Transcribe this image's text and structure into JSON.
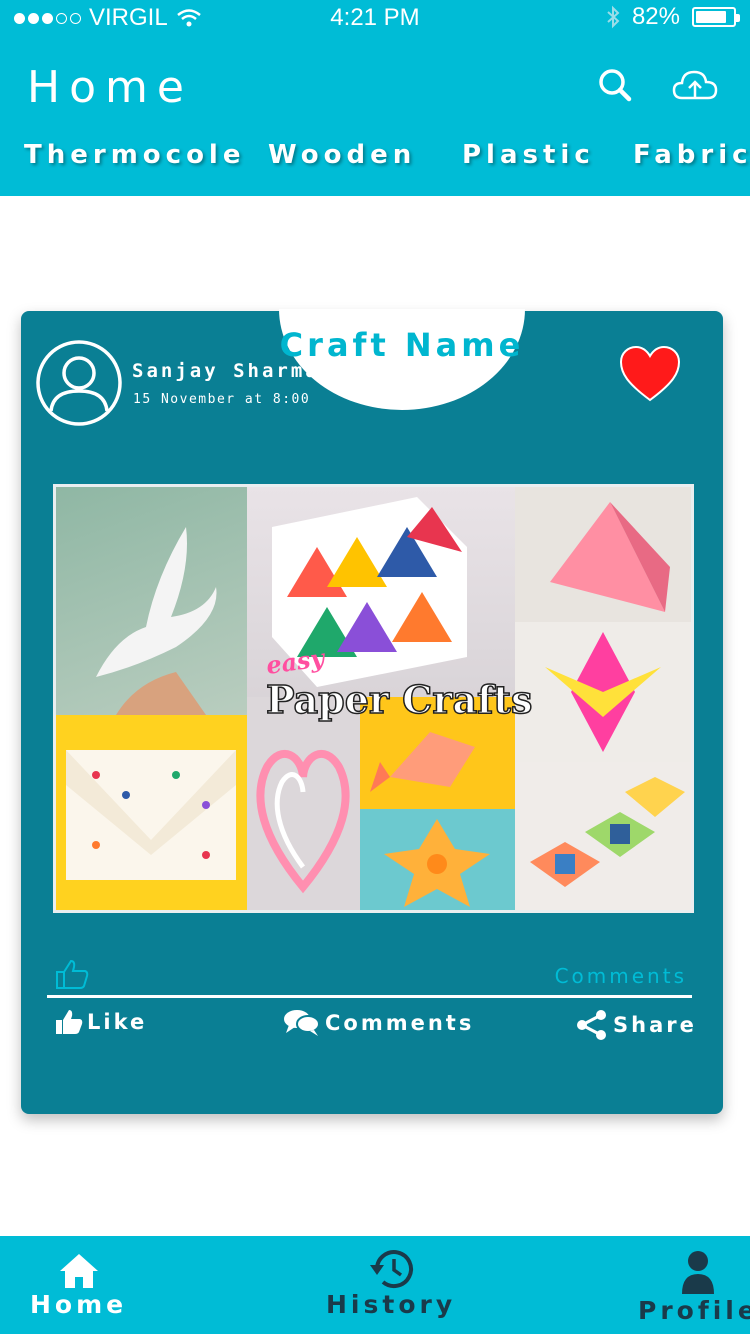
{
  "status_bar": {
    "carrier": "VIRGIL",
    "time": "4:21 PM",
    "battery": "82%",
    "battery_level": 0.82
  },
  "header": {
    "title": "Home",
    "search_icon": "search-icon",
    "upload_icon": "cloud-upload-icon"
  },
  "categories": [
    "Thermocole",
    "Wooden",
    "Plastic",
    "Fabric"
  ],
  "post": {
    "craft_name": "Craft Name",
    "author": "Sanjay Sharma",
    "date": "15 November at 8:00",
    "favorite_icon": "heart-icon",
    "image": {
      "overlay_small": "easy",
      "overlay_title": "Paper Crafts"
    },
    "comments_count_label": "Comments",
    "actions": {
      "like": "Like",
      "comments": "Comments",
      "share": "Share"
    }
  },
  "bottom_nav": {
    "home": "Home",
    "history": "History",
    "profile": "Profile"
  },
  "colors": {
    "brand": "#00bcd6",
    "card": "#0a7f94",
    "heart": "#ff1a1a"
  }
}
